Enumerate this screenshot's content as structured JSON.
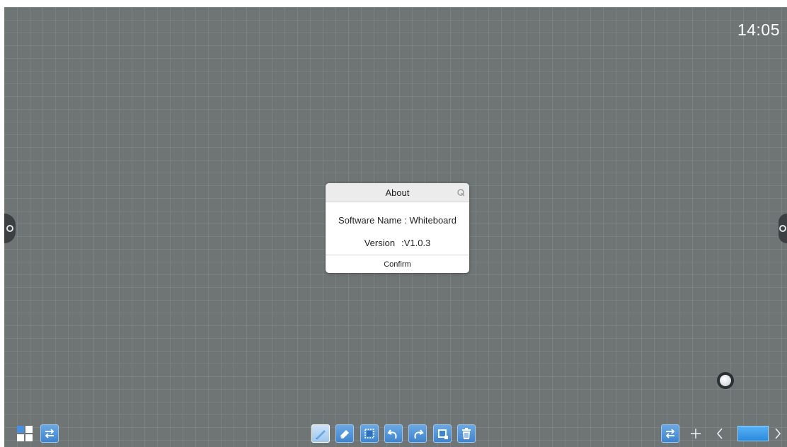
{
  "status": {
    "time": "14:05"
  },
  "dialog": {
    "title": "About",
    "software_label": "Software Name",
    "software_value": "Whiteboard",
    "version_label": "Version",
    "version_value": "V1.0.3",
    "confirm_label": "Confirm"
  },
  "toolbar": {
    "left": [
      "grid-icon",
      "switch-icon"
    ],
    "tools": [
      "pen-icon",
      "eraser-icon",
      "select-icon",
      "undo-icon",
      "redo-icon",
      "crop-icon",
      "trash-icon"
    ],
    "active_tool": "pen-icon",
    "right": [
      "switch-icon",
      "add-page-icon",
      "prev-page-icon",
      "page-thumbnail",
      "next-page-icon"
    ]
  },
  "colors": {
    "board": "#6f7475",
    "accent": "#3f84cf",
    "dialog_header": "#ececec"
  }
}
